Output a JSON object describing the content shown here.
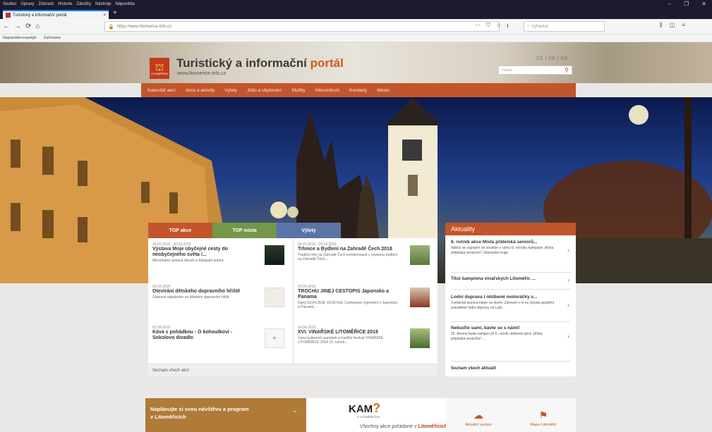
{
  "browser": {
    "menu": [
      "Soubor",
      "Úpravy",
      "Zobrazit",
      "Historie",
      "Záložky",
      "Nástroje",
      "Nápověda"
    ],
    "window_controls": [
      "–",
      "❐",
      "✕"
    ],
    "tab_title": "Turistický a informační portál",
    "tab_close": "×",
    "new_tab": "+",
    "nav_buttons": [
      "←",
      "→",
      "⟳",
      "⌂"
    ],
    "url": "https://www.litomerice-info.cz",
    "url_actions": [
      "⋯",
      "⛉",
      "☆",
      "⭳"
    ],
    "search_placeholder": "Vyhledat",
    "toolbar_right": [
      "⫼",
      "◫",
      "≡"
    ],
    "bookmarks": [
      "Nejnavštěvovanější",
      "Začínáme"
    ]
  },
  "site": {
    "logo_text": "LITOMĚŘICE",
    "title_main": "Turistický a informační ",
    "title_accent": "portál",
    "url": "www.litomerice-info.cz",
    "languages": [
      "CZ",
      "|",
      "DE",
      "|",
      "EN"
    ],
    "search_placeholder": "Hledat",
    "nav": [
      "Kalendář akcí",
      "Akce a aktivity",
      "Výlety",
      "Jídlo a ubytování",
      "Služby",
      "Infocentrum",
      "Kontakty",
      "Město"
    ]
  },
  "content_tabs": [
    "TOP akce",
    "TOP místa",
    "Výlety"
  ],
  "events": {
    "col1": [
      {
        "date": "19.02.2018 - 30.03.2018",
        "title": "Výstava Moje obyčejné cesty do neobyčejného světa /...",
        "desc": "Mimořádná výstava obrazů a fotografií autora"
      },
      {
        "date": "02.04.2018",
        "title": "Otevírání dětského dopravního hřiště",
        "desc": "Zábavné odpoledne na dětském dopravním hřišti"
      },
      {
        "date": "02.04.2018",
        "title": "Káva s pohádkou - O kohoutkovi - Sokolovo divadlo",
        "desc": ""
      }
    ],
    "col2": [
      {
        "date": "24.03.2018 - 25.03.2018",
        "title": "Trhnice a Bydlení na Zahradě Čech 2018",
        "desc": "Tradiční trhy na Zahradě Čech kombinované s výstavou bydlení na Zahradě Čech..."
      },
      {
        "date": "03.04.2018",
        "title": "TROCHU JINEJ CESTOPIS Japonsko a Panama",
        "desc": "Úterý 03.04.2018, 19:00 hod. Cestopisné vyprávění o Japonsku a Panamě..."
      },
      {
        "date": "14.04.2018",
        "title": "XVI. VINAŘSKÉ LITOMĚŘICE 2018",
        "desc": "Cenu kulturních památek a tradiční festival VINAŘSKÉ LITOMĚŘICE 2018 16. ročník..."
      }
    ],
    "footer": "Seznam všech akcí"
  },
  "news": {
    "heading": "Aktuality",
    "items": [
      {
        "title": "6. ročník akce Místa přátelská seniorů...",
        "desc": "Nabízí se zapojení do soutěže v rámci 6. ročníku kampaně „Místa přátelská seniorům“ Ústeckého kraje"
      },
      {
        "title": "Titul šampiona vinařských Litoměřic ...",
        "desc": ""
      },
      {
        "title": "Lodní doprava i oblíbené motoráčky s...",
        "desc": "Turistická sezona klepe na dveře. Zároveň s ní se chystá spuštění pravidelné lodní dopravy na Labi..."
      },
      {
        "title": "Nebuďte sami, bavte se s námi!",
        "desc": "25. březnu bude zahájen již 6. ročník oblíbené akce „Místa přátelská seniorům“..."
      }
    ],
    "footer": "Seznam všech aktualit"
  },
  "plan": {
    "line1": "Naplánujte si svou návštěvu a program",
    "line2": "v Litoměřicích"
  },
  "kam": {
    "logo": "KAM",
    "sub": "V LITOMĚŘICÍCH",
    "text": "Všechny akce pořádané v ",
    "text_b": "Litoměřicích"
  },
  "sidebox": [
    {
      "label": "Aktuální počasí"
    },
    {
      "label": "Mapa Litoměřic"
    }
  ],
  "colors": {
    "accent": "#c2552b",
    "nav": "#c2552b",
    "top_mista": "#74974a",
    "vylety": "#5a74a8",
    "plan": "#b07a38"
  }
}
